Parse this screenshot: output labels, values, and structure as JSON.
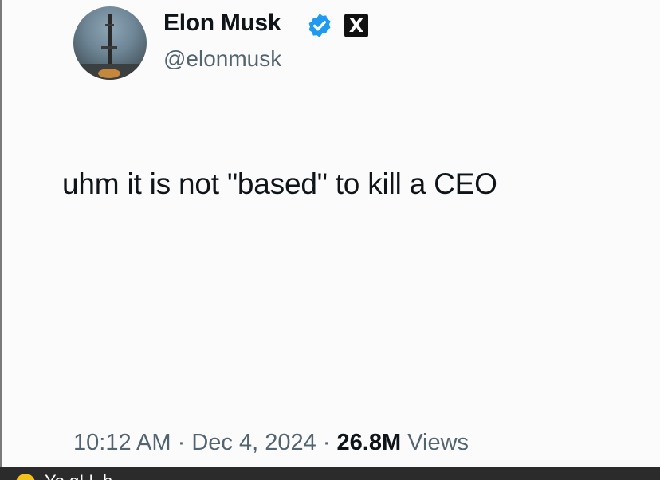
{
  "tweet": {
    "display_name": "Elon Musk",
    "handle": "@elonmusk",
    "verified_color": "#1d9bf0",
    "platform_badge": "X",
    "text": "uhm it is not \"based\" to kill a CEO",
    "time": "10:12 AM",
    "separator": "·",
    "date": "Dec 4, 2024",
    "views_count": "26.8M",
    "views_label": "Views"
  },
  "bottom_bar": {
    "text": "Yo      gI   L   h"
  }
}
